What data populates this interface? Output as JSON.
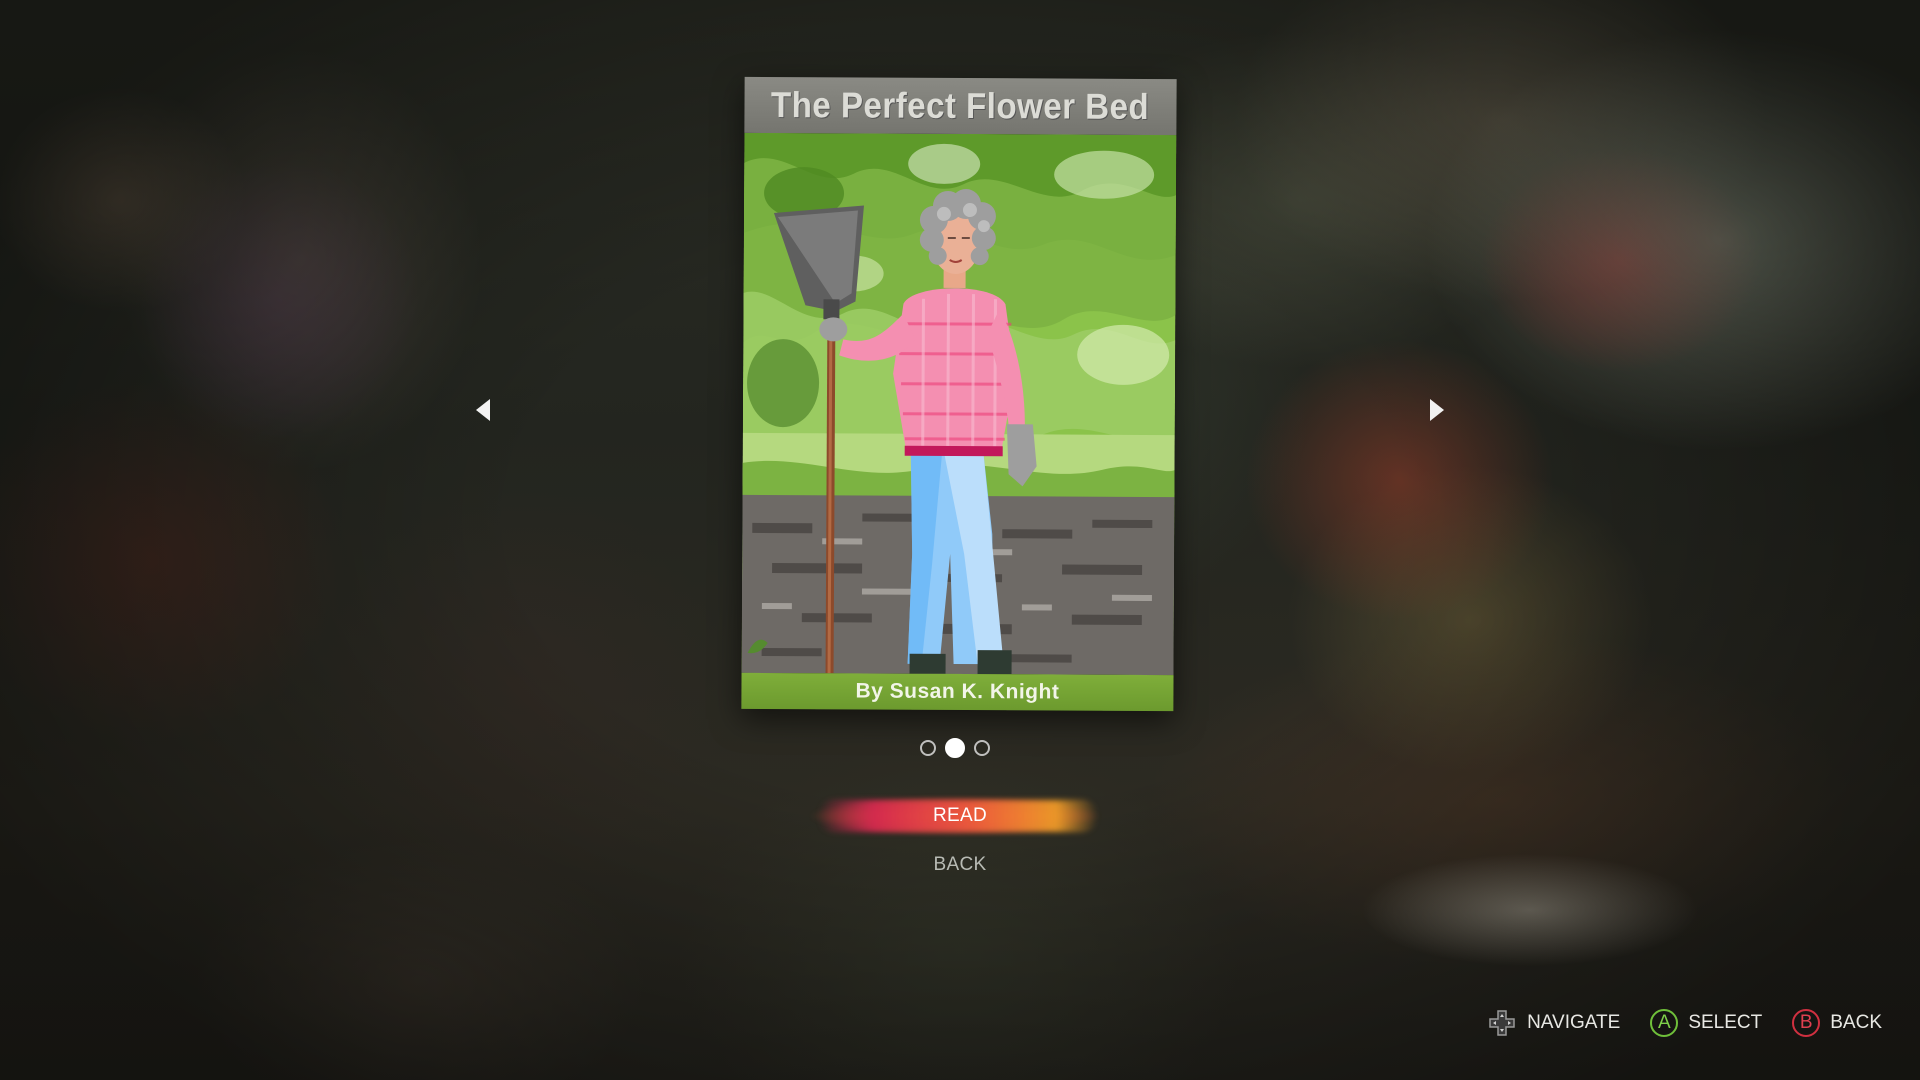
{
  "book": {
    "title": "The Perfect Flower Bed",
    "author": "By Susan K. Knight",
    "colors": {
      "title_band": "#7f7f79",
      "author_band": "#76a434"
    }
  },
  "navigation": {
    "left_arrow_icon": "triangle-left-icon",
    "right_arrow_icon": "triangle-right-icon"
  },
  "pagination": {
    "total": 3,
    "current": 2
  },
  "menu": {
    "items": [
      {
        "label": "READ",
        "selected": true
      },
      {
        "label": "BACK",
        "selected": false
      }
    ],
    "highlight_colors": [
      "#d8285a",
      "#f0782c",
      "#f5aa28"
    ]
  },
  "hints": [
    {
      "icon": "dpad-icon",
      "label": "NAVIGATE"
    },
    {
      "icon": "a-button-icon",
      "glyph": "A",
      "label": "SELECT",
      "color": "#6fbf3a"
    },
    {
      "icon": "b-button-icon",
      "glyph": "B",
      "label": "BACK",
      "color": "#d03040"
    }
  ]
}
